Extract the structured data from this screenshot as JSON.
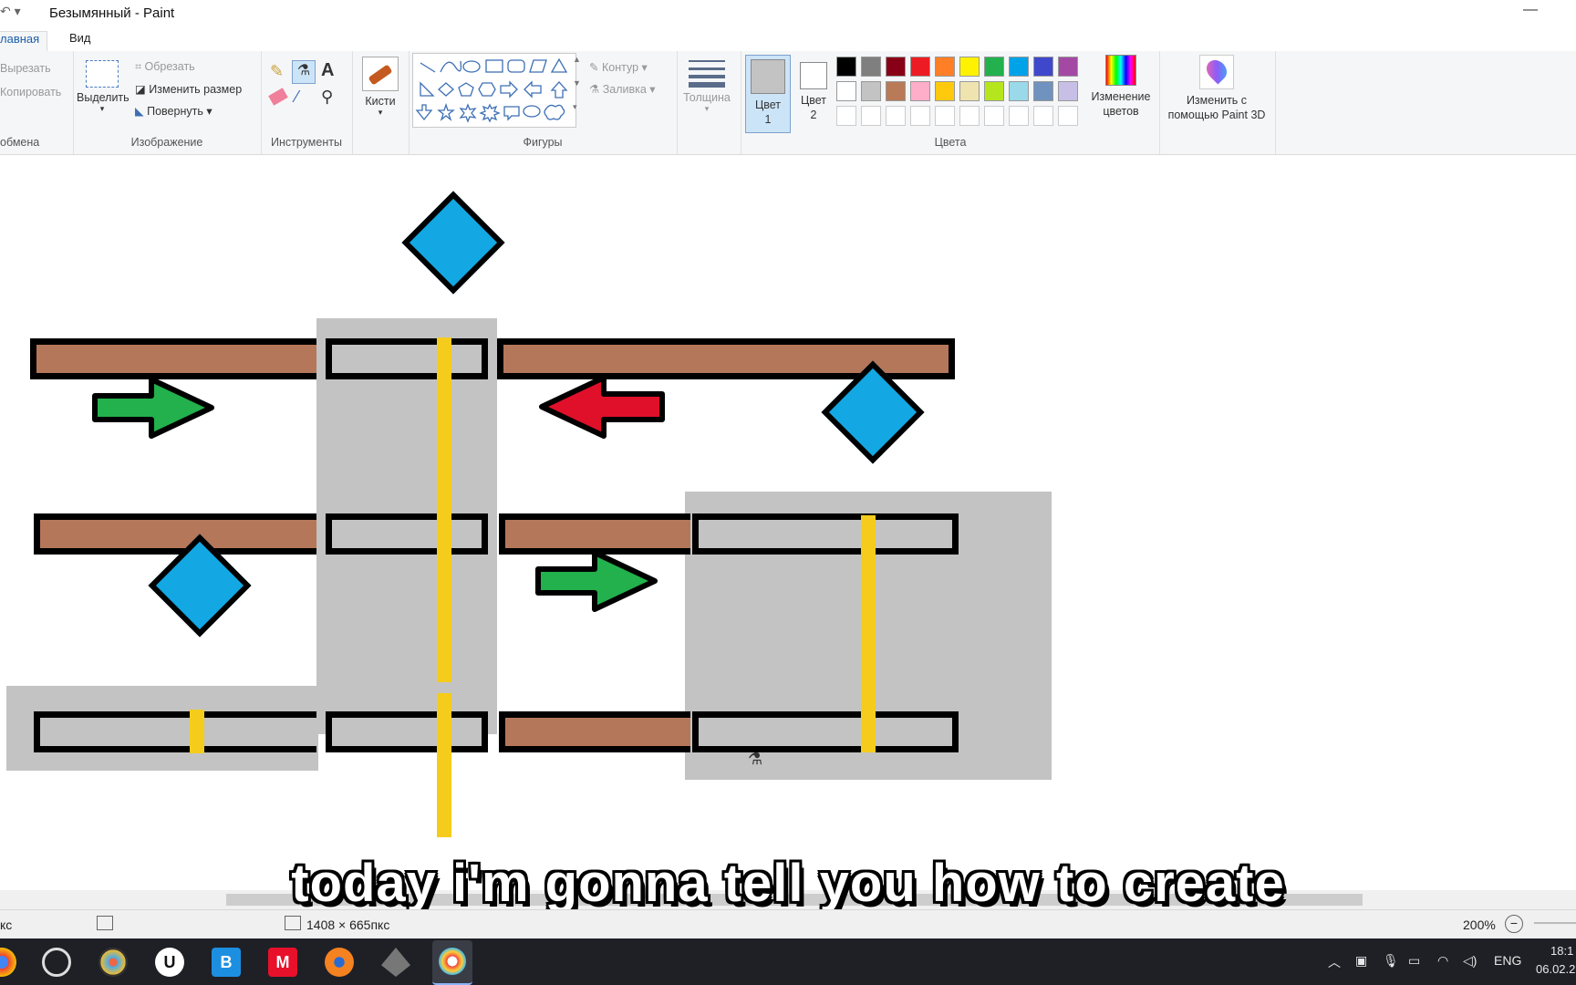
{
  "window": {
    "title": "Безымянный - Paint",
    "quick_access": "↶ ▾",
    "minimize": "—"
  },
  "tabs": {
    "home": "лавная",
    "view": "Вид"
  },
  "ribbon": {
    "clipboard": {
      "cut": "Вырезать",
      "copy": "Копировать",
      "label": "обмена"
    },
    "image": {
      "select": "Выделить",
      "crop": "Обрезать",
      "resize": "Изменить размер",
      "rotate": "Повернуть",
      "label": "Изображение"
    },
    "tools": {
      "label": "Инструменты"
    },
    "brushes": {
      "label": "Кисти"
    },
    "shapes": {
      "outline": "Контур",
      "fill": "Заливка",
      "label": "Фигуры"
    },
    "size": {
      "label": "Толщина"
    },
    "colors": {
      "color1": "Цвет 1",
      "color2": "Цвет 2",
      "edit": "Изменение цветов",
      "paint3d": "Изменить с помощью Paint 3D",
      "label": "Цвета",
      "color1_value": "#c3c3c3",
      "color2_value": "#ffffff",
      "row1": [
        "#000000",
        "#7f7f7f",
        "#880015",
        "#ed1c24",
        "#ff7f27",
        "#fff200",
        "#22b14c",
        "#00a2e8",
        "#3f48cc",
        "#a349a4"
      ],
      "row2": [
        "#ffffff",
        "#c3c3c3",
        "#b97a57",
        "#ffaec9",
        "#ffc90e",
        "#efe4b0",
        "#b5e61d",
        "#99d9ea",
        "#7092be",
        "#c8bfe7"
      ]
    }
  },
  "drawing_colors": {
    "track": "#b5775a",
    "selection": "#c3c3c3",
    "line": "#f5cc1c",
    "gem": "#13a8e3",
    "arrow_green": "#22b14c",
    "arrow_red": "#e0102a"
  },
  "status": {
    "dimensions": "1408 × 665пкс",
    "zoom": "200%",
    "left_fragment": "кс"
  },
  "subtitle": "today i'm gonna tell you how to create",
  "taskbar": {
    "lang": "ENG",
    "time": "18:1",
    "date": "06.02.2"
  }
}
